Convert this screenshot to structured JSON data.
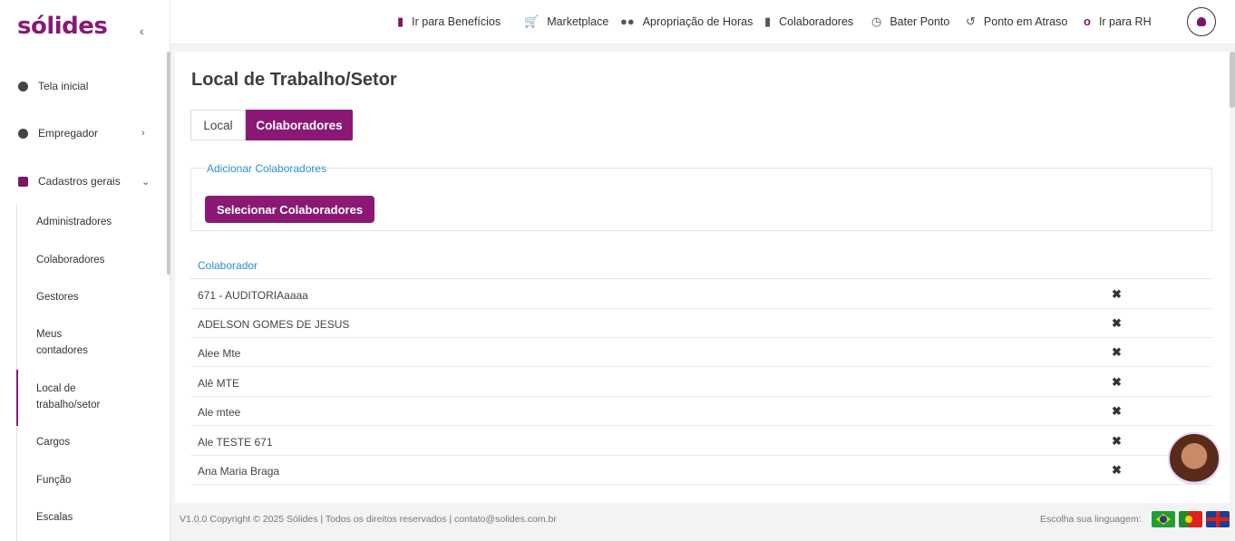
{
  "brand": {
    "logo": "sólides"
  },
  "sidebar": {
    "items": [
      {
        "label": "Tela inicial",
        "icon": "info-icon"
      },
      {
        "label": "Empregador",
        "icon": "user-circle-icon"
      },
      {
        "label": "Cadastros gerais",
        "icon": "plus-square-icon"
      }
    ],
    "subitems": [
      "Administradores",
      "Colaboradores",
      "Gestores",
      "Meus contadores",
      "Local de trabalho/setor",
      "Cargos",
      "Função",
      "Escalas"
    ]
  },
  "topbar": {
    "links": [
      {
        "label": "Ir para Benefícios",
        "icon": "wallet-icon"
      },
      {
        "label": "Marketplace",
        "icon": "cart-icon"
      },
      {
        "label": "Apropriação de Horas",
        "icon": "users-icon"
      },
      {
        "label": "Colaboradores",
        "icon": "book-icon"
      },
      {
        "label": "Bater Ponto",
        "icon": "clock-icon"
      },
      {
        "label": "Ponto em Atraso",
        "icon": "history-icon"
      },
      {
        "label": "Ir para RH",
        "icon": "solides-icon"
      }
    ]
  },
  "page": {
    "title": "Local de Trabalho/Setor",
    "tabs": [
      "Local",
      "Colaboradores"
    ],
    "active_tab": "Colaboradores",
    "legend": "Adicionar Colaboradores",
    "select_button": "Selecionar Colaboradores",
    "column_header": "Colaborador",
    "rows": [
      "671 - AUDITORIAaaaa",
      "ADELSON GOMES DE JESUS",
      "Alee Mte",
      "Alê MTE",
      "Ale mtee",
      "Ale TESTE 671",
      "Ana Maria Braga"
    ],
    "remove_glyph": "✖"
  },
  "footer": {
    "copyright": "V1.0.0 Copyright © 2025 Sólides | Todos os direitos reservados | contato@solides.com.br",
    "language_label": "Escolha sua linguagem:"
  },
  "colors": {
    "accent": "#8b1874",
    "link": "#2a8fcf"
  }
}
